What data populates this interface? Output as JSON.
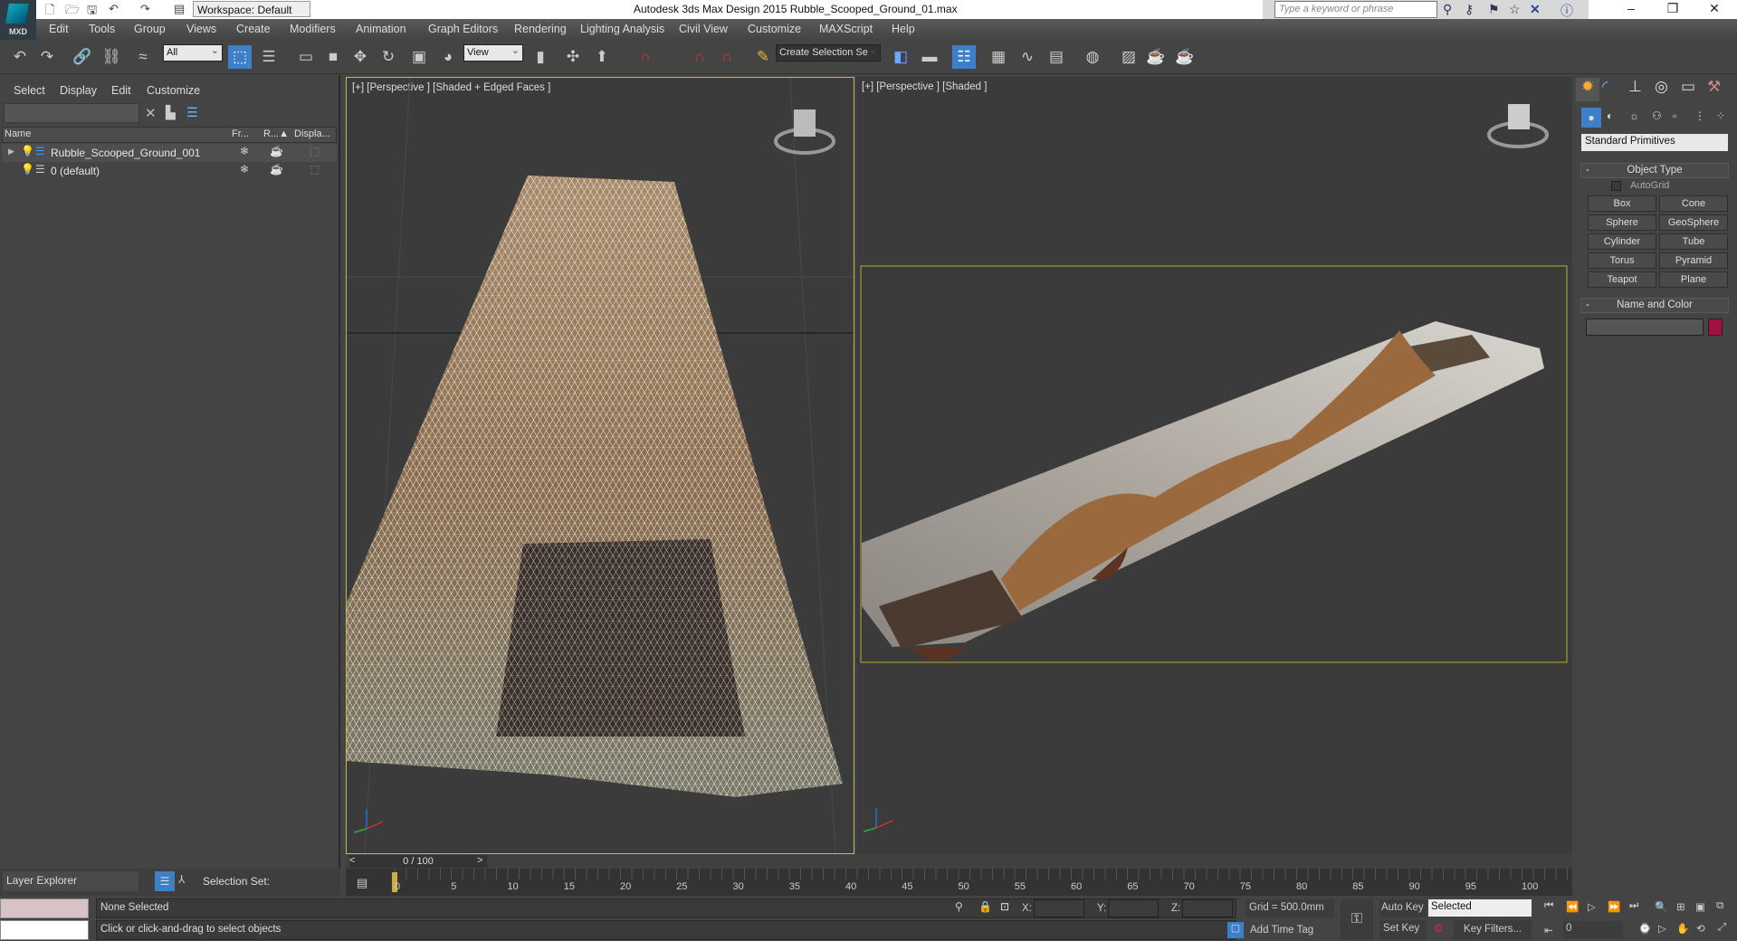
{
  "titlebar": {
    "logo": "MXD",
    "workspace": "Workspace: Default",
    "title": "Autodesk 3ds Max Design 2015    Rubble_Scooped_Ground_01.max",
    "search_placeholder": "Type a keyword or phrase"
  },
  "menu": [
    "Edit",
    "Tools",
    "Group",
    "Views",
    "Create",
    "Modifiers",
    "Animation",
    "Graph Editors",
    "Rendering",
    "Lighting Analysis",
    "Civil View",
    "Customize",
    "MAXScript",
    "Help"
  ],
  "toolbar": {
    "selection_filter": "All",
    "ref_coord": "View",
    "named_selection": "Create Selection Se"
  },
  "scene_explorer": {
    "menu": [
      "Select",
      "Display",
      "Edit",
      "Customize"
    ],
    "columns": [
      "Name",
      "Fr...",
      "R...▲",
      "Displa..."
    ],
    "rows": [
      {
        "name": "Rubble_Scooped_Ground_001"
      },
      {
        "name": "0 (default)"
      }
    ],
    "footer": {
      "explorer": "Layer Explorer",
      "selection_set": "Selection Set:"
    }
  },
  "viewports": {
    "left": "[+] [Perspective ] [Shaded + Edged Faces ]",
    "right": "[+] [Perspective ] [Shaded ]"
  },
  "command_panel": {
    "category": "Standard Primitives",
    "object_type": "Object Type",
    "autogrid": "AutoGrid",
    "buttons": [
      "Box",
      "Cone",
      "Sphere",
      "GeoSphere",
      "Cylinder",
      "Tube",
      "Torus",
      "Pyramid",
      "Teapot",
      "Plane"
    ],
    "name_and_color": "Name and Color",
    "object_color": "#a01040"
  },
  "timeline": {
    "frame": "0 / 100",
    "ticks": [
      "0",
      "5",
      "10",
      "15",
      "20",
      "25",
      "30",
      "35",
      "40",
      "45",
      "50",
      "55",
      "60",
      "65",
      "70",
      "75",
      "80",
      "85",
      "90",
      "95",
      "100"
    ],
    "progress": 0
  },
  "status": {
    "selection": "None Selected",
    "prompt": "Click or click-and-drag to select objects",
    "x_label": "X:",
    "y_label": "Y:",
    "z_label": "Z:",
    "grid": "Grid = 500.0mm",
    "add_time_tag": "Add Time Tag",
    "auto_key": "Auto Key",
    "set_key": "Set Key",
    "key_mode": "Selected",
    "key_filters": "Key Filters...",
    "current_frame": "0"
  }
}
